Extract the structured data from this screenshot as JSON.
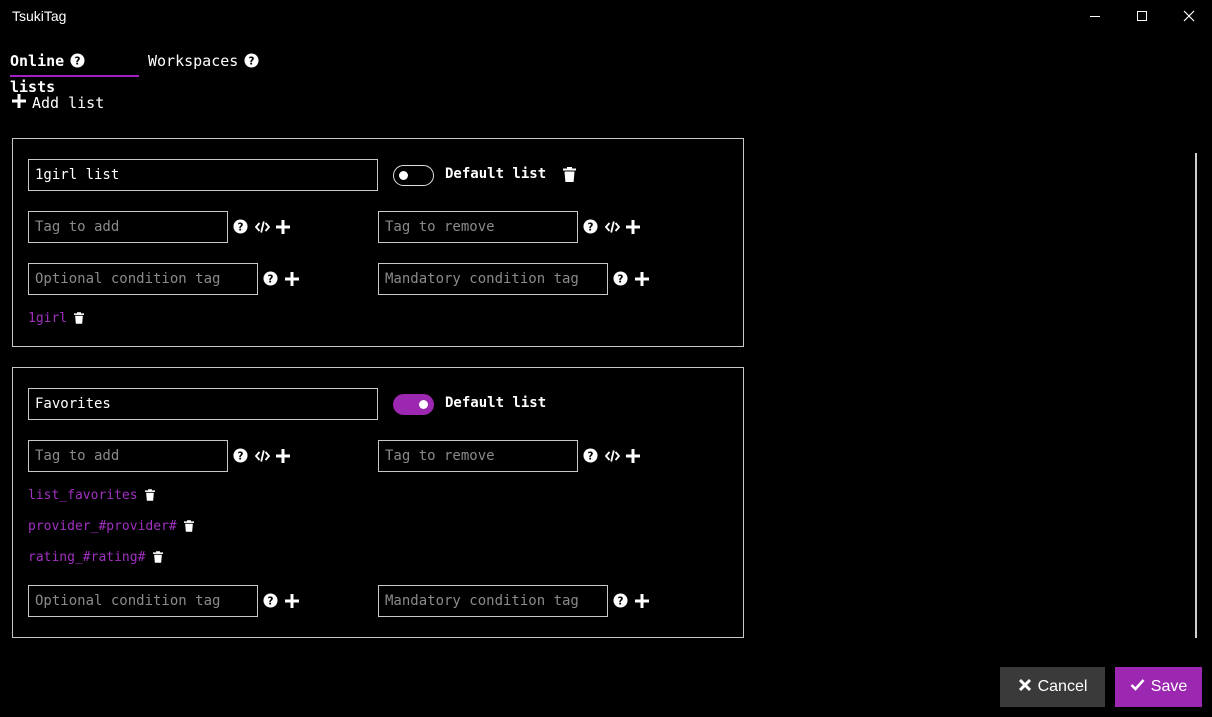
{
  "window": {
    "title": "TsukiTag",
    "controls": [
      "minimize-icon",
      "maximize-icon",
      "close-icon"
    ]
  },
  "tabs": [
    {
      "label": "Online lists",
      "active": true,
      "help_icon": "question-circle-icon"
    },
    {
      "label": "Workspaces",
      "active": false,
      "help_icon": "question-circle-icon"
    }
  ],
  "toolbar": {
    "add_list_label": "Add list",
    "add_list_icon": "plus-icon"
  },
  "lists": [
    {
      "name": "1girl list",
      "default_label": "Default list",
      "default_on": false,
      "tag_add_placeholder": "Tag to add",
      "tag_remove_placeholder": "Tag to remove",
      "optional_condition_placeholder": "Optional condition tag",
      "mandatory_condition_placeholder": "Mandatory condition tag",
      "tags": [
        "1girl"
      ]
    },
    {
      "name": "Favorites",
      "default_label": "Default list",
      "default_on": true,
      "tag_add_placeholder": "Tag to add",
      "tag_remove_placeholder": "Tag to remove",
      "optional_condition_placeholder": "Optional condition tag",
      "mandatory_condition_placeholder": "Mandatory condition tag",
      "tags": [
        "list_favorites",
        "provider_#provider#",
        "rating_#rating#"
      ]
    }
  ],
  "footer": {
    "cancel_label": "Cancel",
    "save_label": "Save"
  },
  "colors": {
    "accent": "#9c27b0",
    "tag_text": "#a030c0",
    "background": "#000000",
    "cancel_bg": "#3a3a3a"
  }
}
